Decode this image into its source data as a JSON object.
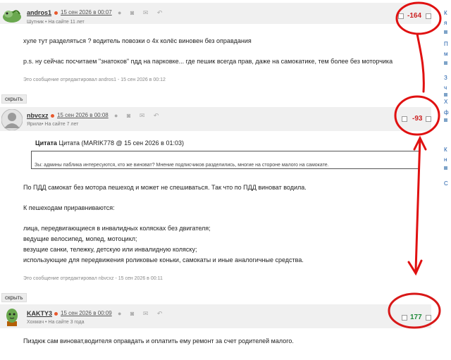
{
  "comments": [
    {
      "username": "andros1",
      "date": "15 сен 2026 в 00:07",
      "rank": "Шутник",
      "tenure": "На сайте 11 лет",
      "rating": "-164",
      "lines": [
        "хуле тут разделяться ? водитель повозки о 4х колёс виновен без оправдания",
        "p.s. ну сейчас посчитаем \"знатоков\" пдд на парковке... где пешик всегда прав, даже на самокатике, тем более без моторчика"
      ],
      "edited": "Это сообщение отредактировал andros1 - 15 сен 2026 в 00:12"
    },
    {
      "username": "nbvcxz",
      "date": "15 сен 2026 в 00:08",
      "rank": "Ярила",
      "tenure": "На сайте 7 лет",
      "rating": "-93",
      "quote_title": "Цитата (MARIK778 @ 15 сен 2026 в 01:03)",
      "quote_text": "Зы: админы паблика интересуются, кто же виноват? Мнение подписчиков разделились, многие на стороне малого на самокате.",
      "lines": [
        "По ПДД самокат без мотора пешеход и может не спешиваться. Так что по ПДД виноват водила.",
        "К пешеходам приравниваются:",
        "лица, передвигающиеся в инвалидных колясках без двигателя;",
        "ведущие велосипед, мопед, мотоцикл;",
        "везущие санки, тележку, детскую или инвалидную коляску;",
        "использующие для передвижения роликовые коньки, самокаты и иные аналогичные средства."
      ],
      "edited": "Это сообщение отредактировал nbvcxz - 15 сен 2026 в 00:11"
    },
    {
      "username": "KAKTY3",
      "date": "15 сен 2026 в 00:09",
      "rank": "Хохмач",
      "tenure": "На сайте 3 года",
      "rating": "177",
      "lines": [
        "Пиздюк сам виноват,водителя оправдать и оплатить ему ремонт за счет родителей малого."
      ]
    }
  ],
  "hide_label": "скрыть",
  "tools_glyphs": "● ◙ ✉ ↶",
  "sidebar_letters": [
    "К",
    "я",
    "П",
    "м",
    "З",
    "ч",
    "Х",
    "ф",
    "К",
    "н",
    "С"
  ],
  "colors": {
    "accent_red": "#cc2222",
    "accent_green": "#1f8a3a",
    "annotation_red": "#e01010",
    "online_dot": "#e8582c"
  }
}
